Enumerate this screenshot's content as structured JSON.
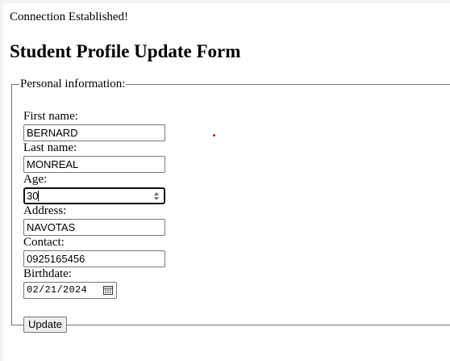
{
  "status_message": "Connection Established!",
  "form": {
    "title": "Student Profile Update Form",
    "fieldset_legend": "Personal information:",
    "fields": [
      {
        "label": "First name:",
        "value": "BERNARD"
      },
      {
        "label": "Last name:",
        "value": "MONREAL"
      },
      {
        "label": "Age:",
        "value": "30"
      },
      {
        "label": "Address:",
        "value": "NAVOTAS"
      },
      {
        "label": "Contact:",
        "value": "0925165456"
      },
      {
        "label": "Birthdate:",
        "value": "02/21/2024"
      }
    ],
    "submit_label": "Update"
  },
  "icons": {
    "age_spinner": "spinner-arrows-icon",
    "birthdate_picker": "calendar-icon"
  },
  "colors": {
    "marker_dot": "#c41e2a",
    "field_border": "#767676",
    "focused_border": "#101010"
  }
}
